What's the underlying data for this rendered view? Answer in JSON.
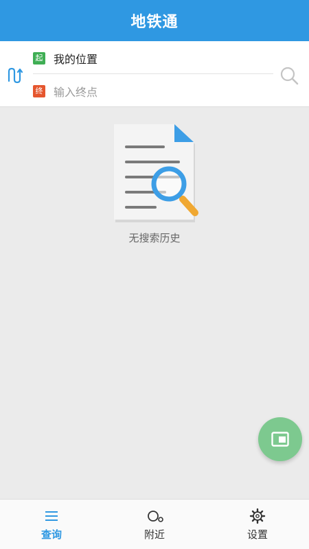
{
  "header": {
    "title": "地铁通"
  },
  "route": {
    "start_badge": "起",
    "start_value": "我的位置",
    "end_badge": "终",
    "end_placeholder": "输入终点"
  },
  "empty_state": {
    "message": "无搜索历史"
  },
  "tabs": [
    {
      "label": "查询",
      "icon": "menu-icon",
      "active": true
    },
    {
      "label": "附近",
      "icon": "nearby-icon",
      "active": false
    },
    {
      "label": "设置",
      "icon": "gear-icon",
      "active": false
    }
  ],
  "colors": {
    "accent": "#2f98e2",
    "start_badge": "#3fae54",
    "end_badge": "#e5562e",
    "fab": "#7dc98f"
  }
}
